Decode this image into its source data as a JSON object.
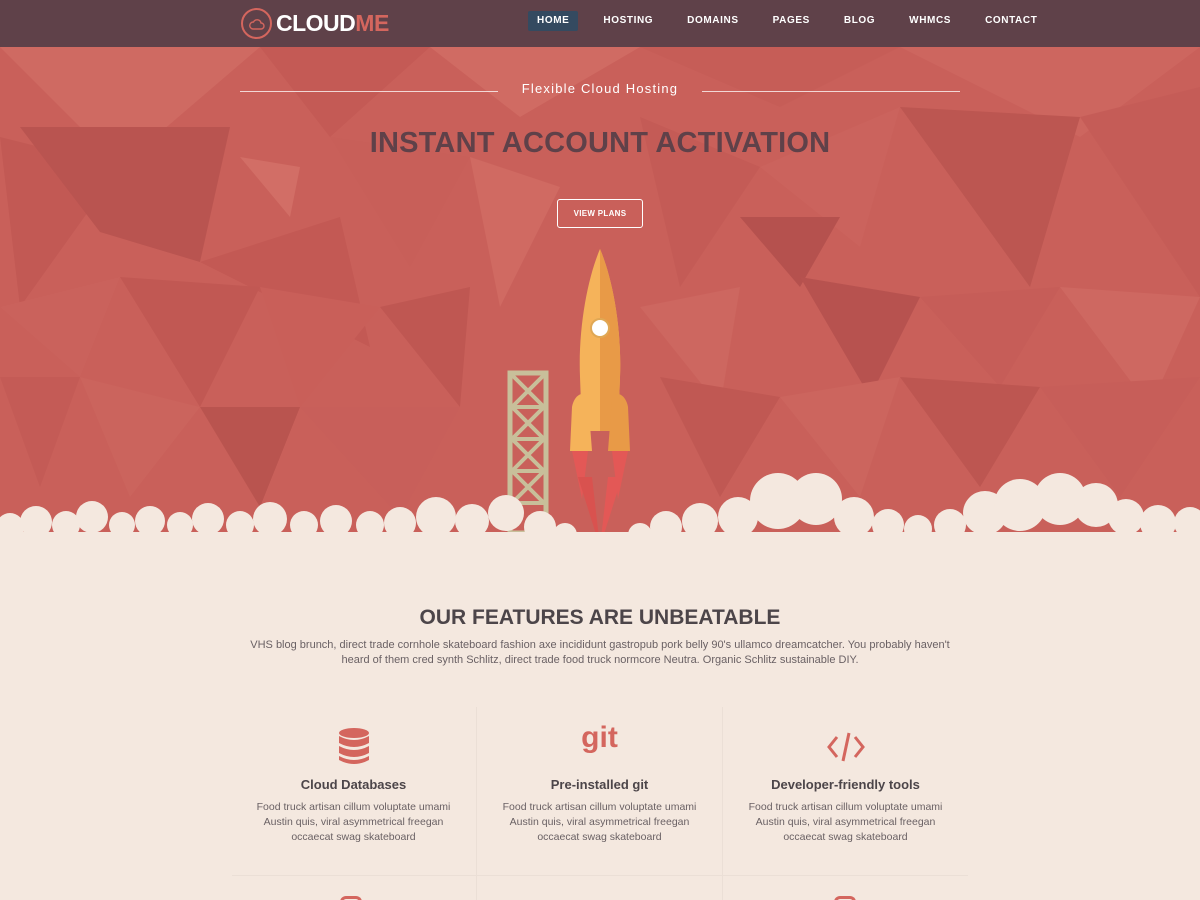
{
  "brand": {
    "name_part1": "CLOUD",
    "name_part2": "ME"
  },
  "nav": {
    "items": [
      {
        "label": "HOME",
        "active": true
      },
      {
        "label": "HOSTING",
        "active": false
      },
      {
        "label": "DOMAINS",
        "active": false
      },
      {
        "label": "PAGES",
        "active": false
      },
      {
        "label": "BLOG",
        "active": false
      },
      {
        "label": "WHMCS",
        "active": false
      },
      {
        "label": "CONTACT",
        "active": false
      }
    ]
  },
  "hero": {
    "tagline": "Flexible Cloud Hosting",
    "headline": "INSTANT ACCOUNT ACTIVATION",
    "cta_label": "VIEW PLANS"
  },
  "features": {
    "title": "OUR FEATURES ARE UNBEATABLE",
    "description": "VHS blog brunch, direct trade cornhole skateboard fashion axe incididunt gastropub pork belly 90's ullamco dreamcatcher. You probably haven't heard of them cred synth Schlitz, direct trade food truck normcore Neutra. Organic Schlitz sustainable DIY.",
    "cards": [
      {
        "icon": "database-icon",
        "title": "Cloud Databases",
        "text": "Food truck artisan cillum voluptate umami Austin quis, viral asymmetrical freegan occaecat swag skateboard"
      },
      {
        "icon": "git-icon",
        "icon_text": "git",
        "title": "Pre-installed git",
        "text": "Food truck artisan cillum voluptate umami Austin quis, viral asymmetrical freegan occaecat swag skateboard"
      },
      {
        "icon": "code-icon",
        "title": "Developer-friendly tools",
        "text": "Food truck artisan cillum voluptate umami Austin quis, viral asymmetrical freegan occaecat swag skateboard"
      }
    ]
  },
  "colors": {
    "nav_bg": "#5f4149",
    "nav_active": "#344a60",
    "accent": "#d4665e",
    "hero_bg": "#c9605a",
    "headline": "#5f4149",
    "page_bg": "#f4e8df",
    "rocket_body": "#f5b35a",
    "rocket_flame": "#e35856",
    "tower": "#c8bf9a"
  }
}
